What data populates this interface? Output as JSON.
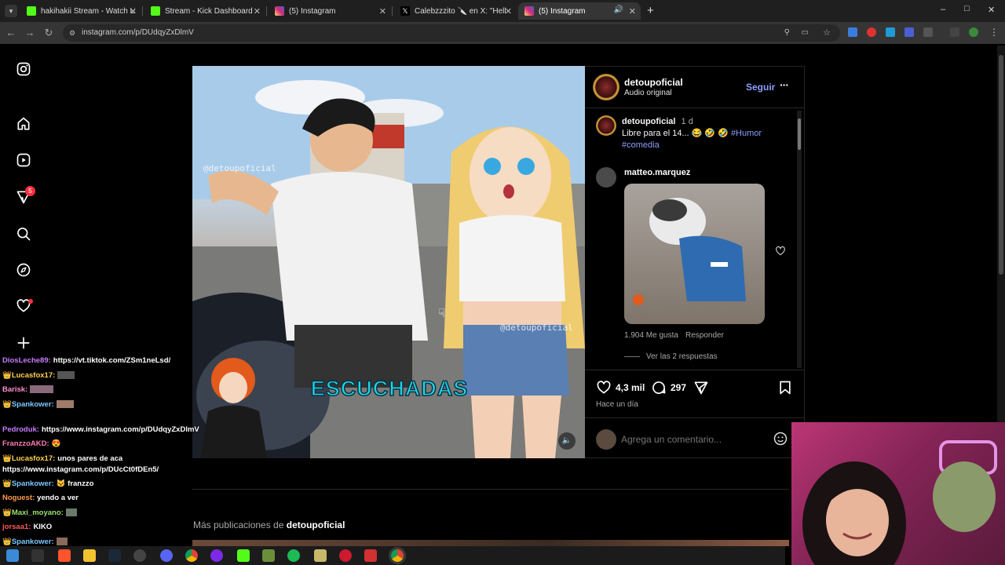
{
  "browser": {
    "tabs": [
      {
        "label": "hakihakii Stream - Watch Live o",
        "color": "#53fc18"
      },
      {
        "label": "Stream - Kick Dashboard",
        "color": "#53fc18"
      },
      {
        "label": "(5) Instagram",
        "color": "#d62976"
      },
      {
        "label": "Calebzzzito 🔪 en X: \"Hell nah",
        "color": "#ffffff"
      },
      {
        "label": "(5) Instagram",
        "color": "#d62976"
      }
    ],
    "new_tab": "+",
    "url": "instagram.com/p/DUdqyZxDlmV",
    "window_controls": [
      "–",
      "□",
      "✕"
    ]
  },
  "instagram": {
    "nav_badge": "5",
    "post": {
      "username": "detoupoficial",
      "subtitle": "Audio original",
      "follow": "Seguir",
      "more": "···",
      "watermark": "@detoupoficial",
      "overlay_text": "ESCUCHADAS",
      "caption_user": "detoupoficial",
      "caption_time": "1 d",
      "caption_text": "Libre para el 14... 😂 🤣 🤣",
      "hashtag1": "#Humor",
      "hashtag2": "#comedia",
      "comment_user": "matteo.marquez",
      "comment_likes": "1.904 Me gusta",
      "comment_reply": "Responder",
      "view_replies": "Ver las 2 respuestas",
      "likes": "4,3 mil",
      "comments": "297",
      "time_ago": "Hace un día",
      "add_comment_placeholder": "Agrega un comentario..."
    },
    "more_posts_prefix": "Más publicaciones de",
    "more_posts_user": "detoupoficial"
  },
  "chat": [
    {
      "user": "DiosLeche89:",
      "text": "https://vt.tiktok.com/ZSm1neLsd/",
      "color": "#c77dff"
    },
    {
      "user": "👑Lucasfox17:",
      "text": "",
      "color": "#ffd24d"
    },
    {
      "user": "Barisk:",
      "text": "",
      "color": "#ff8fd1"
    },
    {
      "user": "👑Spankower:",
      "text": "",
      "color": "#7cc8ff"
    },
    {
      "user": "Pedroduk:",
      "text": "https://www.instagram.com/p/DUdqyZxDlmV",
      "color": "#c77dff"
    },
    {
      "user": "FranzzoAKD:",
      "text": "😍",
      "color": "#ff7ab6"
    },
    {
      "user": "👑Lucasfox17:",
      "text": "unos pares de aca",
      "color": "#ffd24d"
    },
    {
      "user": "",
      "text": "https://www.instagram.com/p/DUcCt0fDEn5/",
      "color": "#ffffff"
    },
    {
      "user": "👑Spankower:",
      "text": "🐱 franzzo",
      "color": "#7cc8ff"
    },
    {
      "user": "Noguest:",
      "text": "yendo a ver",
      "color": "#ff9b4d"
    },
    {
      "user": "👑Maxi_moyano:",
      "text": "",
      "color": "#9be36b"
    },
    {
      "user": "jorsaa1:",
      "text": "KIKO",
      "color": "#ff5a5a"
    },
    {
      "user": "👑Spankower:",
      "text": "",
      "color": "#7cc8ff"
    }
  ],
  "colors": {
    "accent_blue": "#8c9eff",
    "hashtag": "#8c9eff",
    "badge_red": "#ff3040"
  }
}
